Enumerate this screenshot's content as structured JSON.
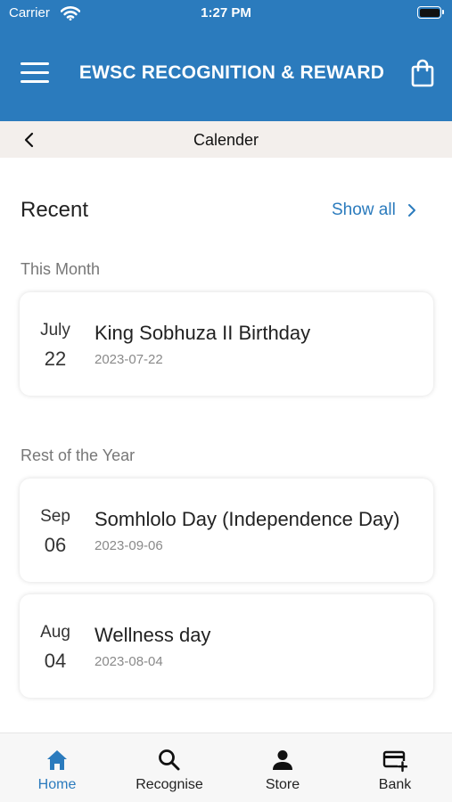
{
  "status_bar": {
    "carrier": "Carrier",
    "time": "1:27 PM"
  },
  "header": {
    "title": "EWSC RECOGNITION & REWARD",
    "menu_icon": "menu-icon",
    "cart_icon": "shopping-bag-icon"
  },
  "subheader": {
    "title": "Calender",
    "back_icon": "chevron-left-icon"
  },
  "recent": {
    "heading": "Recent",
    "show_all": "Show all"
  },
  "sections": {
    "this_month": {
      "label": "This Month",
      "events": [
        {
          "month": "July",
          "day": "22",
          "title": "King Sobhuza II Birthday",
          "date": "2023-07-22"
        }
      ]
    },
    "rest_of_year": {
      "label": "Rest of the Year",
      "events": [
        {
          "month": "Sep",
          "day": "06",
          "title": "Somhlolo Day (Independence Day)",
          "date": "2023-09-06"
        },
        {
          "month": "Aug",
          "day": "04",
          "title": "Wellness day",
          "date": "2023-08-04"
        }
      ]
    }
  },
  "tabs": [
    {
      "label": "Home",
      "icon": "home-icon",
      "active": true
    },
    {
      "label": "Recognise",
      "icon": "search-icon",
      "active": false
    },
    {
      "label": "Store",
      "icon": "person-icon",
      "active": false
    },
    {
      "label": "Bank",
      "icon": "card-add-icon",
      "active": false
    }
  ],
  "colors": {
    "primary": "#2b7bbd",
    "subheader_bg": "#f3efec",
    "tabbar_bg": "#f7f7f7"
  }
}
